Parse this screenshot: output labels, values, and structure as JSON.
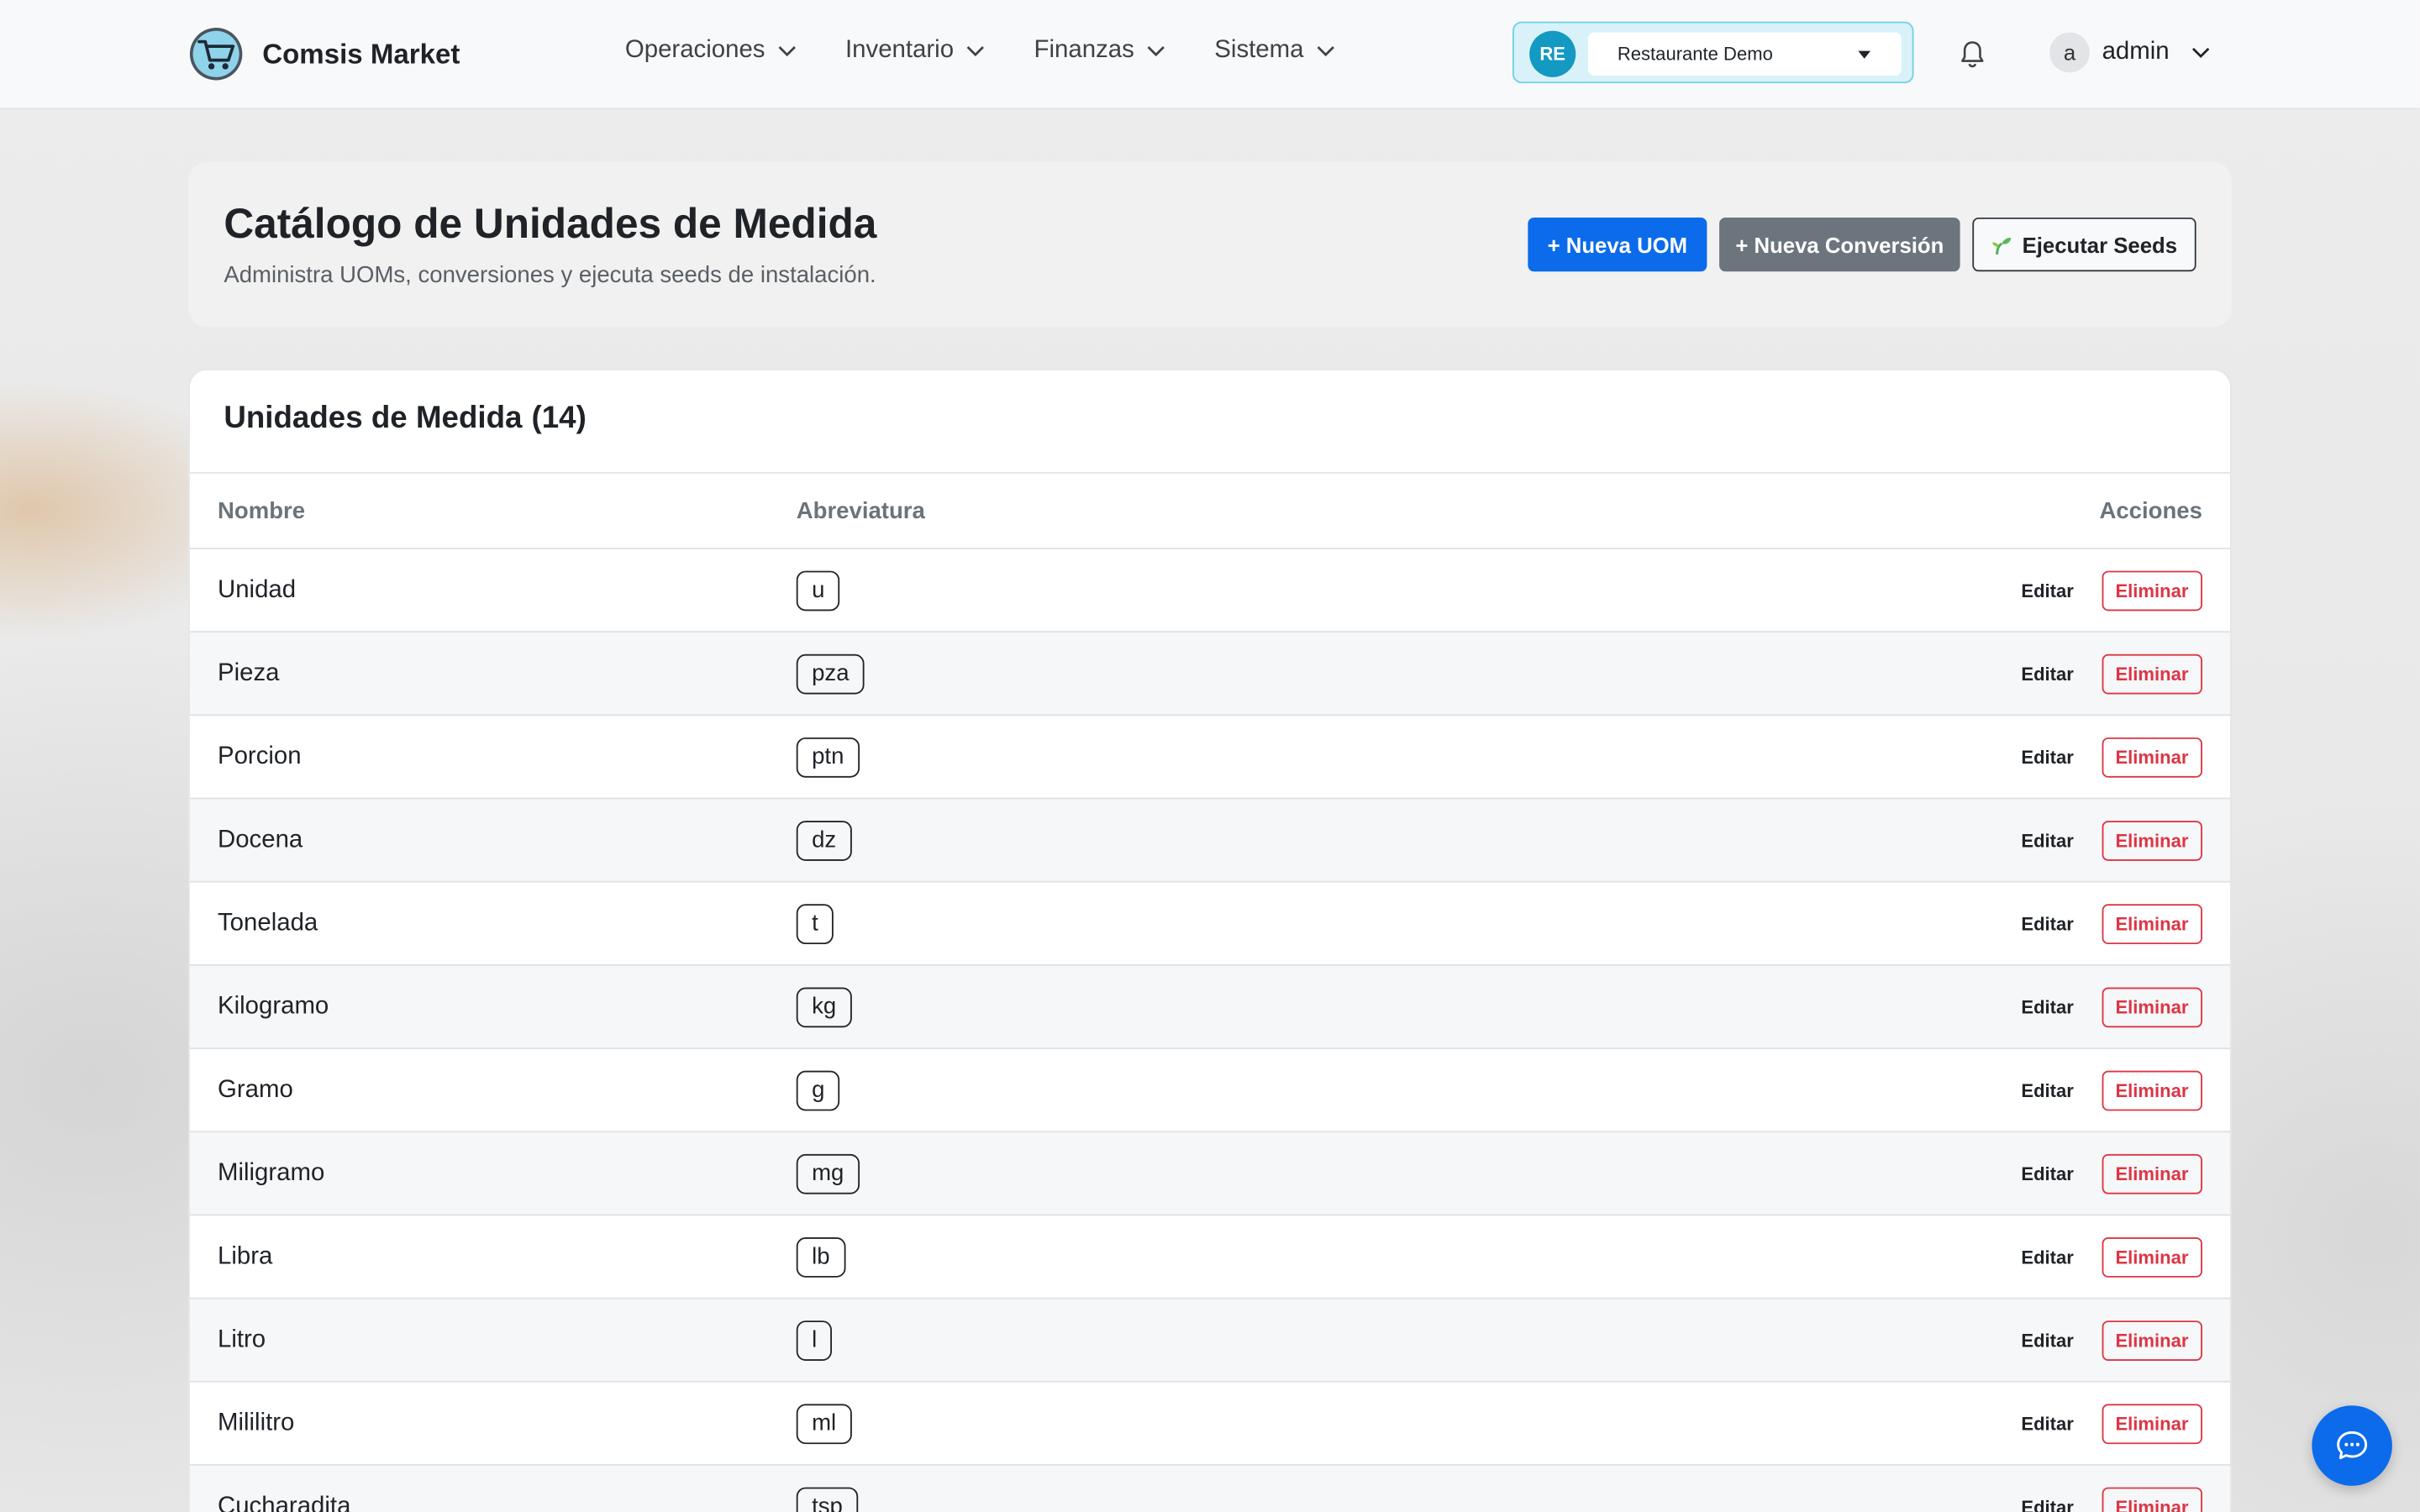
{
  "brand": {
    "name": "Comsis Market",
    "logo_icon": "shopping-cart-icon"
  },
  "nav": {
    "items": [
      {
        "label": "Operaciones"
      },
      {
        "label": "Inventario"
      },
      {
        "label": "Finanzas"
      },
      {
        "label": "Sistema"
      }
    ]
  },
  "tenant": {
    "initials": "RE",
    "selected": "Restaurante Demo"
  },
  "user": {
    "initial": "a",
    "name": "admin"
  },
  "page": {
    "title": "Catálogo de Unidades de Medida",
    "subtitle": "Administra UOMs, conversiones y ejecuta seeds de instalación.",
    "buttons": {
      "new_uom": "+ Nueva UOM",
      "new_conversion": "+ Nueva Conversión",
      "run_seeds": "Ejecutar Seeds"
    }
  },
  "uom_table": {
    "title": "Unidades de Medida",
    "count": "(14)",
    "columns": {
      "name": "Nombre",
      "abbr": "Abreviatura",
      "actions": "Acciones"
    },
    "edit_label": "Editar",
    "delete_label": "Eliminar",
    "rows": [
      {
        "name": "Unidad",
        "abbr": "u"
      },
      {
        "name": "Pieza",
        "abbr": "pza"
      },
      {
        "name": "Porcion",
        "abbr": "ptn"
      },
      {
        "name": "Docena",
        "abbr": "dz"
      },
      {
        "name": "Tonelada",
        "abbr": "t"
      },
      {
        "name": "Kilogramo",
        "abbr": "kg"
      },
      {
        "name": "Gramo",
        "abbr": "g"
      },
      {
        "name": "Miligramo",
        "abbr": "mg"
      },
      {
        "name": "Libra",
        "abbr": "lb"
      },
      {
        "name": "Litro",
        "abbr": "l"
      },
      {
        "name": "Mililitro",
        "abbr": "ml"
      },
      {
        "name": "Cucharadita",
        "abbr": "tsp"
      }
    ]
  },
  "colors": {
    "primary": "#0b6bea",
    "secondary": "#6c757d",
    "danger": "#dc3545",
    "tenant_accent": "#1499c2"
  }
}
